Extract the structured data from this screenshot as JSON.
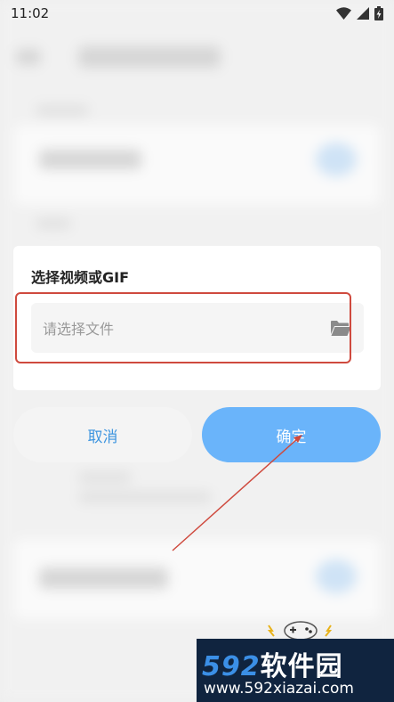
{
  "status_bar": {
    "time": "11:02"
  },
  "dialog": {
    "title": "选择视频或GIF",
    "file_placeholder": "请选择文件"
  },
  "buttons": {
    "cancel": "取消",
    "confirm": "确定"
  },
  "watermark": {
    "brand_num": "592",
    "brand_text": "软件园",
    "url": "www.592xiazai.com"
  },
  "colors": {
    "accent": "#6ab4fa",
    "cancel_text": "#3e95df",
    "highlight": "#cf4a3e"
  }
}
